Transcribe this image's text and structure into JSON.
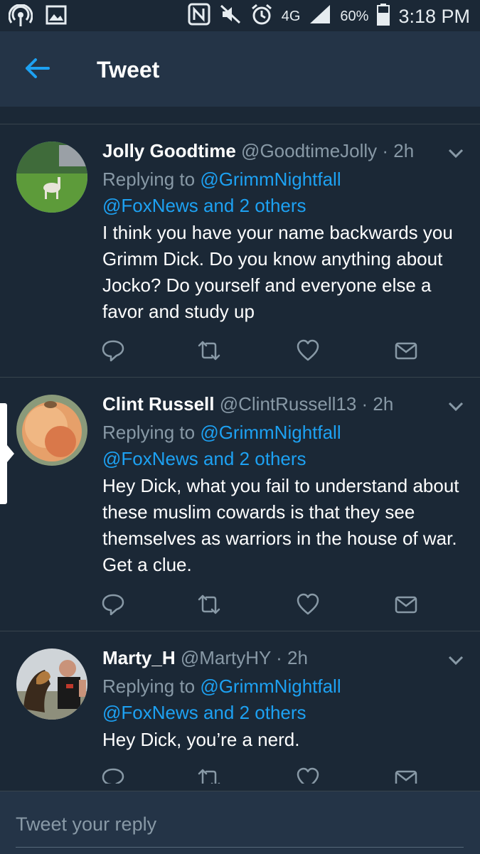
{
  "status_bar": {
    "network": "4G",
    "battery": "60%",
    "time": "3:18 PM"
  },
  "toolbar": {
    "title": "Tweet"
  },
  "tweets": [
    {
      "name": "Jolly Goodtime",
      "handle": "@GoodtimeJolly",
      "time": "· 2h",
      "replying_prefix": "Replying to ",
      "replying_user": "@GrimmNightfall",
      "replying_others": "@FoxNews and 2 others",
      "text": "I think you have your name backwards you Grimm Dick. Do you know anything about Jocko? Do yourself and everyone else a favor and study up"
    },
    {
      "name": "Clint Russell",
      "handle": "@ClintRussell13",
      "time": "· 2h",
      "replying_prefix": "Replying to ",
      "replying_user": "@GrimmNightfall",
      "replying_others": "@FoxNews and 2 others",
      "text": "Hey Dick, what you fail to understand about these muslim cowards is that they see themselves as warriors in the house of war. Get a clue."
    },
    {
      "name": "Marty_H",
      "handle": "@MartyHY",
      "time": "· 2h",
      "replying_prefix": "Replying to ",
      "replying_user": "@GrimmNightfall",
      "replying_others": "@FoxNews and 2 others",
      "text": "Hey Dick, you’re a nerd."
    }
  ],
  "composer": {
    "placeholder": "Tweet your reply"
  },
  "colors": {
    "background": "#1b2836",
    "toolbar": "#243447",
    "link": "#1da1f2",
    "secondary_text": "#8899a6",
    "divider": "#38444d"
  }
}
